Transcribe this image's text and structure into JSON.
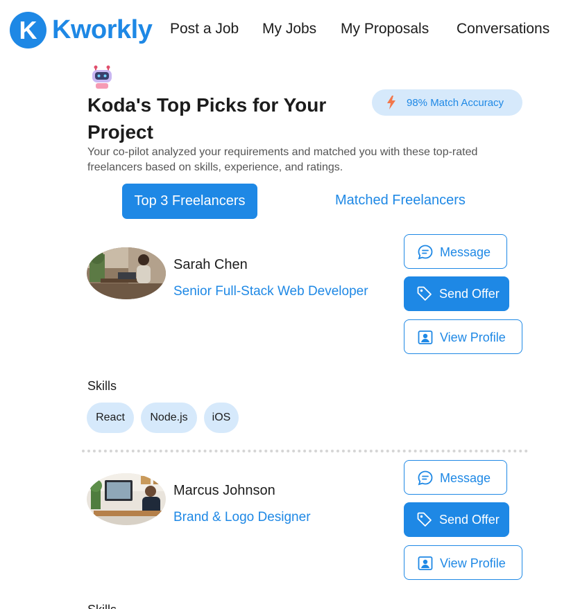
{
  "app": {
    "logo_letter": "K",
    "name": "Kworkly",
    "brand_color": "#1e88e5"
  },
  "nav": {
    "items": [
      {
        "label": "Post a Job"
      },
      {
        "label": "My Jobs"
      },
      {
        "label": "My Proposals"
      },
      {
        "label": "Conversations"
      }
    ]
  },
  "hero": {
    "bot_icon": "robot-icon",
    "title": "Koda's Top Picks for Your Project",
    "accuracy_icon": "lightning-icon",
    "accuracy_label": "98% Match Accuracy",
    "subtitle": "Your co-pilot analyzed your requirements and matched you with these top-rated freelancers based on skills, experience, and ratings."
  },
  "tabs": [
    {
      "label": "Top 3 Freelancers",
      "active": true
    },
    {
      "label": "Matched Freelancers",
      "active": false
    }
  ],
  "actions": {
    "message_label": "Message",
    "message_icon": "chat-bubble-icon",
    "offer_label": "Send Offer",
    "offer_icon": "tag-icon",
    "profile_label": "View Profile",
    "profile_icon": "profile-card-icon"
  },
  "skills_heading": "Skills",
  "freelancers": [
    {
      "name": "Sarah Chen",
      "role": "Senior Full-Stack Web Developer",
      "skills": [
        "React",
        "Node.js",
        "iOS"
      ]
    },
    {
      "name": "Marcus Johnson",
      "role": "Brand & Logo Designer",
      "skills": []
    }
  ],
  "truncated_heading": "Skills"
}
